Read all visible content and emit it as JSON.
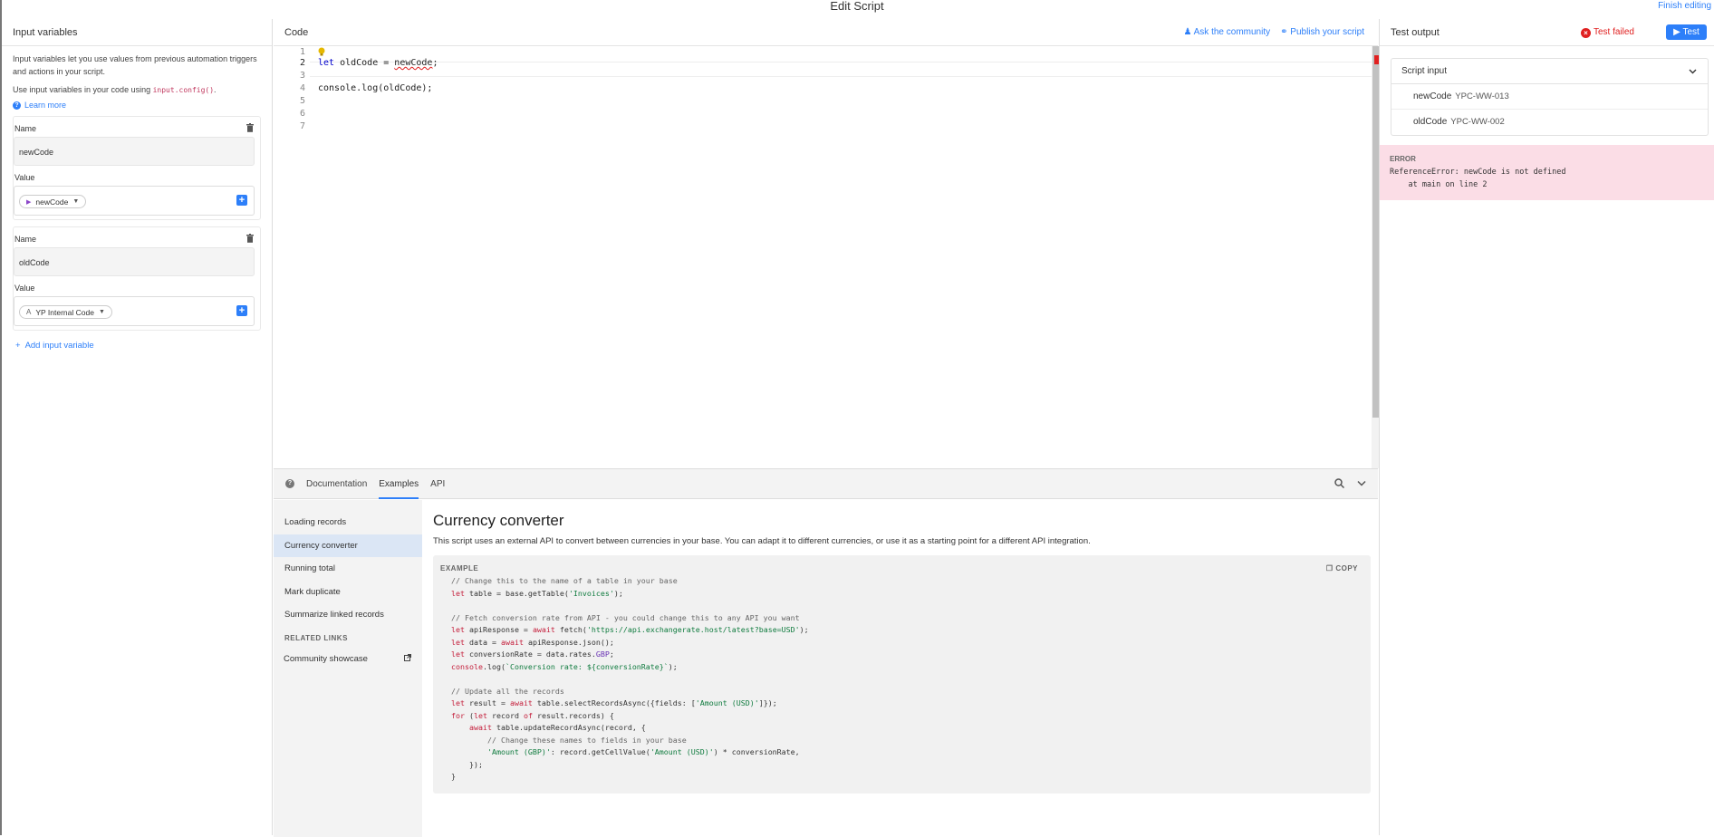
{
  "window": {
    "title": "Edit Script",
    "finish_label": "Finish editing"
  },
  "left_panel": {
    "title": "Input variables",
    "intro_1": "Input variables let you use values from previous automation triggers and actions in your script.",
    "intro_2_prefix": "Use input variables in your code using",
    "intro_2_code": "input.config()",
    "intro_2_suffix": ".",
    "learn_more": "Learn more",
    "variables": [
      {
        "name_label": "Name",
        "name": "newCode",
        "value_label": "Value",
        "value": "newCode",
        "value_icon": "trigger-icon"
      },
      {
        "name_label": "Name",
        "name": "oldCode",
        "value_label": "Value",
        "value": "YP Internal Code",
        "value_icon": "text-field-icon"
      }
    ],
    "add_label": "Add input variable"
  },
  "code_panel": {
    "title": "Code",
    "ask_community": "Ask the community",
    "publish": "Publish your script",
    "line_numbers": [
      "1",
      "2",
      "3",
      "4",
      "5",
      "6",
      "7"
    ],
    "lines": {
      "l2_kw": "let",
      "l2_a": " oldCode = ",
      "l2_err": "newCode",
      "l2_b": ";",
      "l4": "console.log(oldCode);"
    }
  },
  "docs_panel": {
    "tabs": [
      "Documentation",
      "Examples",
      "API"
    ],
    "active_tab": "Examples",
    "nav_items": [
      "Loading records",
      "Currency converter",
      "Running total",
      "Mark duplicate",
      "Summarize linked records"
    ],
    "selected_nav": "Currency converter",
    "related_links_title": "RELATED LINKS",
    "related_links": [
      "Community showcase"
    ],
    "example_title": "Currency converter",
    "example_desc": "This script uses an external API to convert between currencies in your base. You can adapt it to different currencies, or use it as a starting point for a different API integration.",
    "example_label": "EXAMPLE",
    "copy_label": "COPY",
    "code": {
      "c1": "// Change this to the name of a table in your base",
      "t1a": "let",
      "t1b": " table = base.getTable(",
      "t1c": "'Invoices'",
      "t1d": ");",
      "c2": "// Fetch conversion rate from API - you could change this to any API you want",
      "t2a": "let",
      "t2b": " apiResponse = ",
      "t2c": "await",
      "t2d": " fetch(",
      "t2e": "'https://api.exchangerate.host/latest?base=USD'",
      "t2f": ");",
      "t3a": "let",
      "t3b": " data = ",
      "t3c": "await",
      "t3d": " apiResponse.json();",
      "t4a": "let",
      "t4b": " conversionRate = data.rates.",
      "t4c": "GBP",
      "t4d": ";",
      "t5a": "console",
      "t5b": ".log(",
      "t5c": "`Conversion rate: ${conversionRate}`",
      "t5d": ");",
      "c3": "// Update all the records",
      "t6a": "let",
      "t6b": " result = ",
      "t6c": "await",
      "t6d": " table.selectRecordsAsync({fields: [",
      "t6e": "'Amount (USD)'",
      "t6f": "]});",
      "t7a": "for",
      "t7b": " (",
      "t7c": "let",
      "t7d": " record ",
      "t7e": "of",
      "t7f": " result.records) {",
      "t8a": "    await",
      "t8b": " table.updateRecordAsync(record, {",
      "c4": "        // Change these names to fields in your base",
      "t9a": "        'Amount (GBP)'",
      "t9b": ": record.getCellValue(",
      "t9c": "'Amount (USD)'",
      "t9d": ") * conversionRate,",
      "t10": "    });",
      "t11": "}"
    }
  },
  "right_panel": {
    "title": "Test output",
    "status": "Test failed",
    "test_label": "Test",
    "script_input_label": "Script input",
    "inputs": [
      {
        "key": "newCode",
        "value": "YPC-WW-013"
      },
      {
        "key": "oldCode",
        "value": "YPC-WW-002"
      }
    ],
    "error_title": "ERROR",
    "error_line1": "ReferenceError: newCode is not defined",
    "error_line2": "    at main on line 2"
  },
  "colors": {
    "accent": "#2d7ff9",
    "error": "#e02020",
    "error_bg": "#fbdde6"
  }
}
